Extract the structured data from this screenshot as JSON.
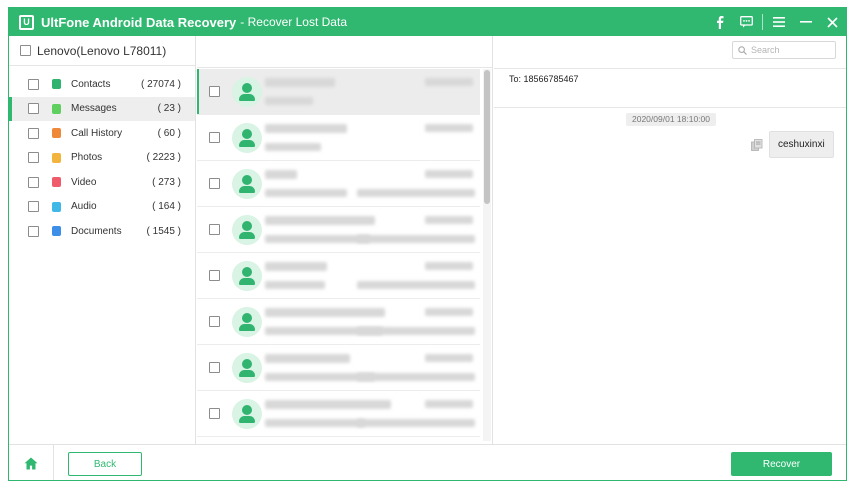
{
  "titlebar": {
    "app_name": "UltFone Android Data Recovery",
    "subtitle": "- Recover Lost Data",
    "brand_color": "#30b871",
    "controls": [
      "facebook-icon",
      "feedback-icon",
      "menu-icon",
      "minimize-icon",
      "close-icon"
    ]
  },
  "device": {
    "label": "Lenovo(Lenovo L78011)",
    "checked": false
  },
  "categories": [
    {
      "label": "Contacts",
      "count": "( 27074 )",
      "icon": "contacts-icon",
      "color": "#2fb36f",
      "active": false
    },
    {
      "label": "Messages",
      "count": "( 23 )",
      "icon": "messages-icon",
      "color": "#5fcf5f",
      "active": true
    },
    {
      "label": "Call History",
      "count": "( 60 )",
      "icon": "call-history-icon",
      "color": "#f0883a",
      "active": false
    },
    {
      "label": "Photos",
      "count": "( 2223 )",
      "icon": "photos-icon",
      "color": "#f2b43c",
      "active": false
    },
    {
      "label": "Video",
      "count": "( 273 )",
      "icon": "video-icon",
      "color": "#ef5b6a",
      "active": false
    },
    {
      "label": "Audio",
      "count": "( 164 )",
      "icon": "audio-icon",
      "color": "#3fb8e8",
      "active": false
    },
    {
      "label": "Documents",
      "count": "( 1545 )",
      "icon": "documents-icon",
      "color": "#3d8ee8",
      "active": false
    }
  ],
  "conversations": {
    "row_count": 8,
    "selected_index": 0,
    "content_visibility": "blurred"
  },
  "search": {
    "placeholder": "Search",
    "value": ""
  },
  "message_view": {
    "to": "To: 18566785467",
    "date": "2020/09/01 18:10:00",
    "message": "ceshuxinxi"
  },
  "footer": {
    "back_label": "Back",
    "recover_label": "Recover"
  }
}
